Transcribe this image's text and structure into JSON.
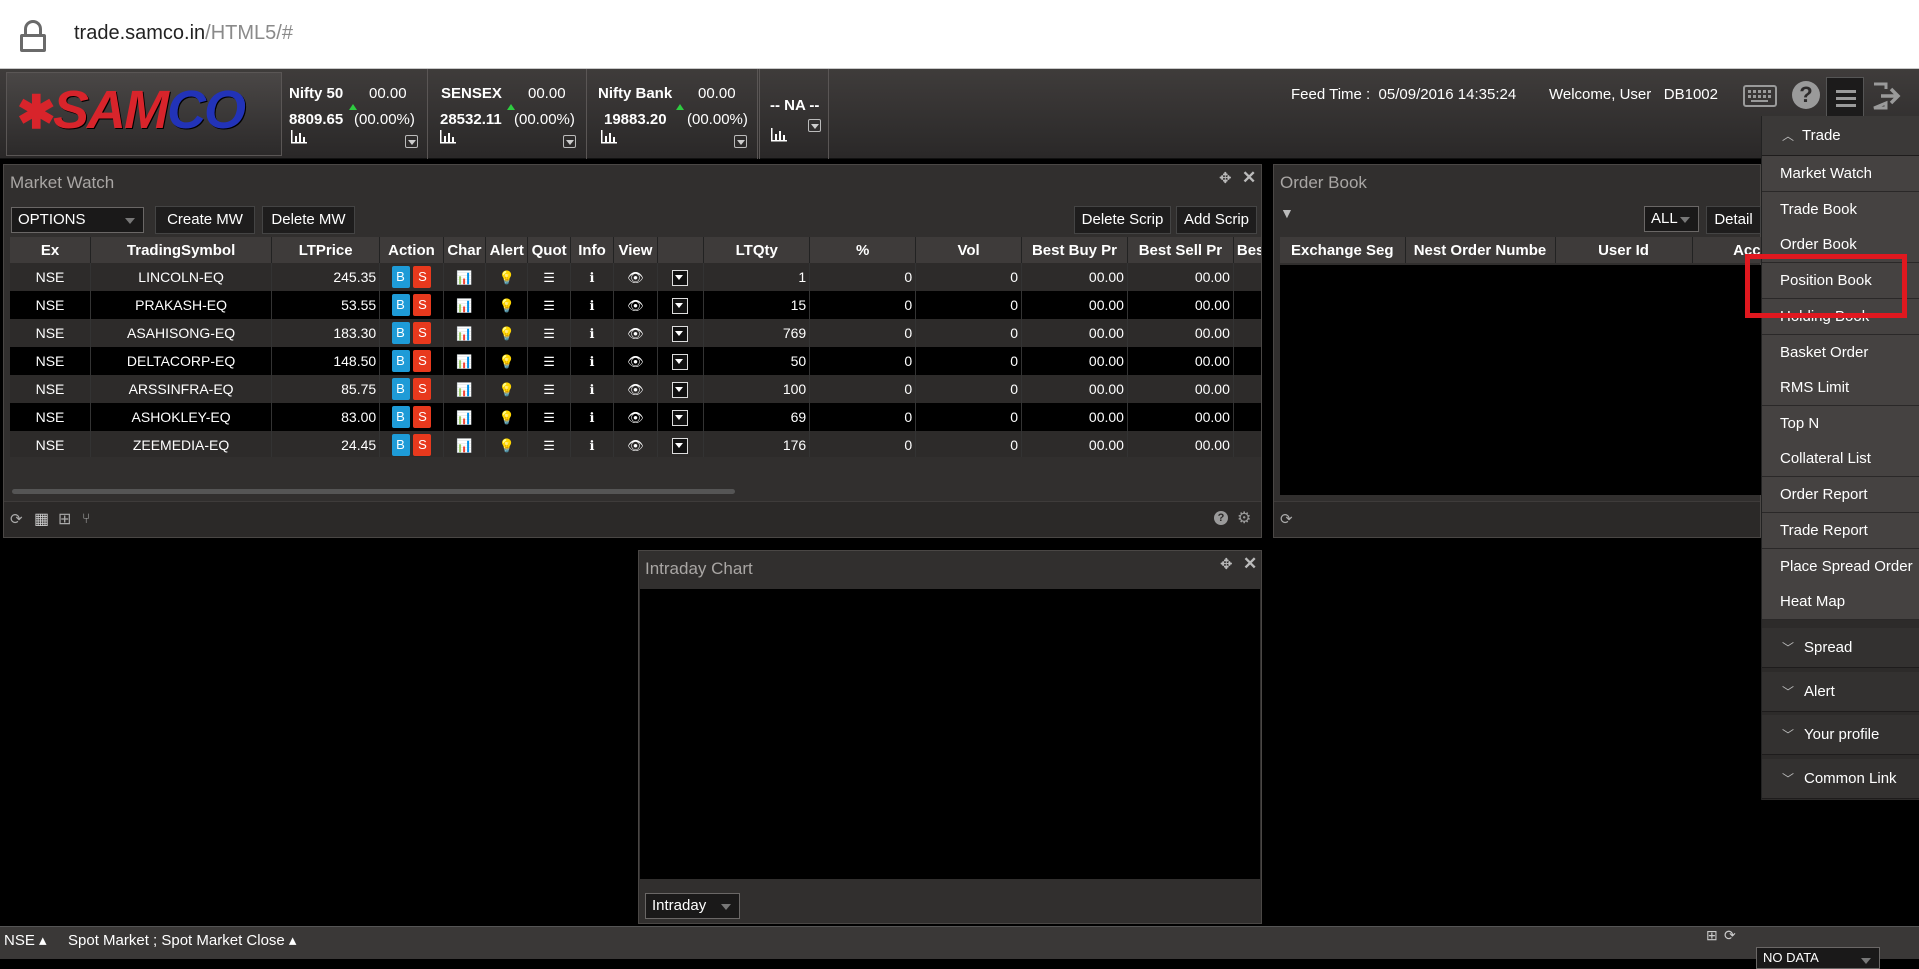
{
  "browser": {
    "url_host": "trade.samco.in",
    "url_path": "/HTML5/#"
  },
  "brand": {
    "logo_text_a": "SAM",
    "logo_text_b": "CO",
    "red": "#d8242b",
    "blue": "#2233b8"
  },
  "indices": [
    {
      "name": "Nifty 50",
      "change": "00.00",
      "value": "8809.65",
      "pct": "(00.00%)"
    },
    {
      "name": "SENSEX",
      "change": "00.00",
      "value": "28532.11",
      "pct": "(00.00%)"
    },
    {
      "name": "Nifty Bank",
      "change": "00.00",
      "value": "19883.20",
      "pct": "(00.00%)"
    },
    {
      "name": "-- NA --"
    }
  ],
  "header": {
    "feed_label": "Feed Time :",
    "feed_time": "05/09/2016 14:35:24",
    "welcome": "Welcome, User",
    "user_id": "DB1002"
  },
  "market_watch": {
    "title": "Market Watch",
    "select_value": "OPTIONS",
    "create": "Create MW",
    "delete": "Delete MW",
    "delete_scrip": "Delete Scrip",
    "add_scrip": "Add Scrip",
    "columns": [
      "Ex",
      "TradingSymbol",
      "LTPrice",
      "Action",
      "Char",
      "Alert",
      "Quot",
      "Info",
      "View",
      "",
      "LTQty",
      "%",
      "Vol",
      "Best Buy Pr",
      "Best Sell Pr",
      "Best Buy"
    ],
    "buy_label": "B",
    "sell_label": "S",
    "rows": [
      {
        "ex": "NSE",
        "sym": "LINCOLN-EQ",
        "ltp": "245.35",
        "qty": "1",
        "pct": "0",
        "vol": "0",
        "bb": "00.00",
        "bs": "00.00"
      },
      {
        "ex": "NSE",
        "sym": "PRAKASH-EQ",
        "ltp": "53.55",
        "qty": "15",
        "pct": "0",
        "vol": "0",
        "bb": "00.00",
        "bs": "00.00"
      },
      {
        "ex": "NSE",
        "sym": "ASAHISONG-EQ",
        "ltp": "183.30",
        "qty": "769",
        "pct": "0",
        "vol": "0",
        "bb": "00.00",
        "bs": "00.00"
      },
      {
        "ex": "NSE",
        "sym": "DELTACORP-EQ",
        "ltp": "148.50",
        "qty": "50",
        "pct": "0",
        "vol": "0",
        "bb": "00.00",
        "bs": "00.00"
      },
      {
        "ex": "NSE",
        "sym": "ARSSINFRA-EQ",
        "ltp": "85.75",
        "qty": "100",
        "pct": "0",
        "vol": "0",
        "bb": "00.00",
        "bs": "00.00"
      },
      {
        "ex": "NSE",
        "sym": "ASHOKLEY-EQ",
        "ltp": "83.00",
        "qty": "69",
        "pct": "0",
        "vol": "0",
        "bb": "00.00",
        "bs": "00.00"
      },
      {
        "ex": "NSE",
        "sym": "ZEEMEDIA-EQ",
        "ltp": "24.45",
        "qty": "176",
        "pct": "0",
        "vol": "0",
        "bb": "00.00",
        "bs": "00.00"
      }
    ]
  },
  "order_book": {
    "title": "Order Book",
    "filter_value": "ALL",
    "detail": "Detail",
    "columns": [
      "Exchange Seg",
      "Nest Order Numbe",
      "User Id",
      "Accou"
    ]
  },
  "intraday_chart": {
    "title": "Intraday Chart",
    "select_value": "Intraday"
  },
  "menu": {
    "trade_header": "Trade",
    "items": [
      "Market Watch",
      "Trade Book",
      "Order Book",
      "Position Book",
      "Holding Book",
      "Basket Order",
      "RMS Limit",
      "Top N",
      "Collateral List",
      "Order Report",
      "Trade Report",
      "Place Spread Order",
      "Heat Map"
    ],
    "groups": [
      "Spread",
      "Alert",
      "Your profile",
      "Common Link"
    ]
  },
  "status_bar": {
    "exchange": "NSE",
    "market_status": "Spot Market ; Spot Market Close",
    "right_select": "NO DATA"
  },
  "highlight_color": "#e0181f"
}
